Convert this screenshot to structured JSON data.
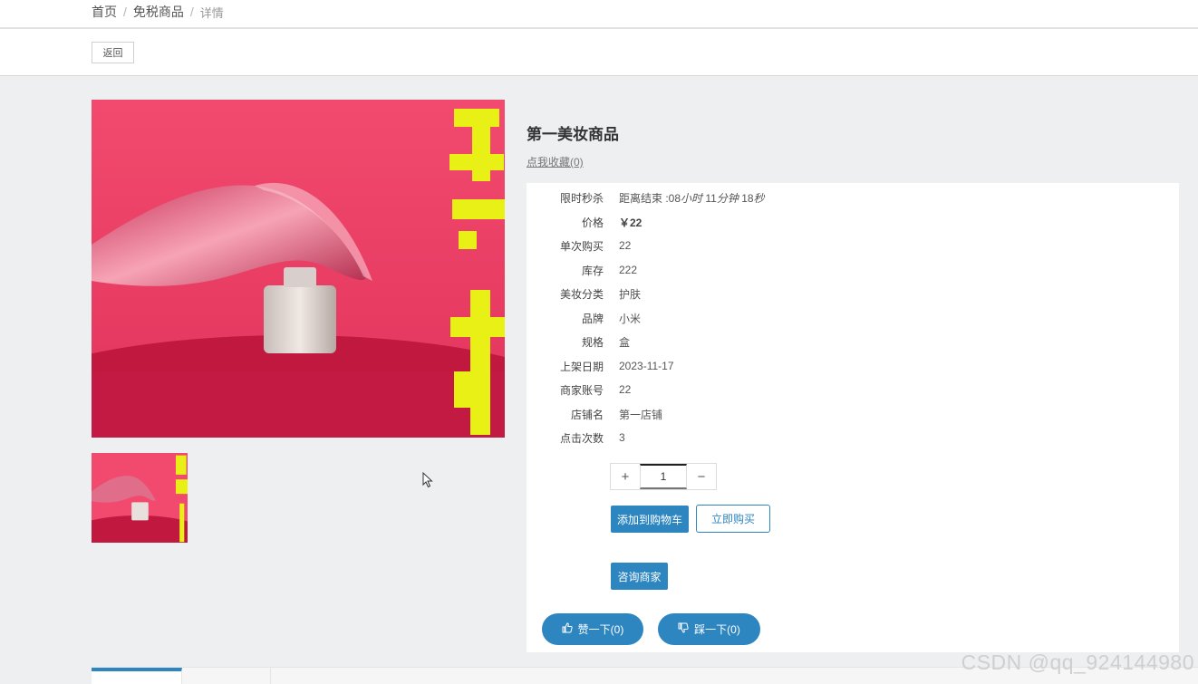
{
  "breadcrumb": {
    "home": "首页",
    "section": "免税商品",
    "current": "详情",
    "separator": "/"
  },
  "toolbar": {
    "back_label": "返回"
  },
  "product": {
    "title": "第一美妆商品",
    "favorite_label": "点我收藏(0)",
    "flash_sale": {
      "label": "限时秒杀",
      "prefix": "距离结束 :08",
      "hours_unit": "小时",
      "minutes": " 11",
      "minutes_unit": "分钟",
      "seconds": " 18",
      "seconds_unit": "秒"
    },
    "attributes": [
      {
        "label": "价格",
        "value": "￥22"
      },
      {
        "label": "单次购买",
        "value": "22"
      },
      {
        "label": "库存",
        "value": "222"
      },
      {
        "label": "美妆分类",
        "value": "护肤"
      },
      {
        "label": "品牌",
        "value": "小米"
      },
      {
        "label": "规格",
        "value": "盒"
      },
      {
        "label": "上架日期",
        "value": "2023-11-17"
      },
      {
        "label": "商家账号",
        "value": "22"
      },
      {
        "label": "店铺名",
        "value": "第一店铺"
      },
      {
        "label": "点击次数",
        "value": "3"
      }
    ],
    "quantity": {
      "value": "1",
      "plus": "+",
      "minus": "−"
    }
  },
  "actions": {
    "add_to_cart": "添加到购物车",
    "buy_now": "立即购买",
    "consult": "咨询商家",
    "like": "赞一下(0)",
    "dislike": "踩一下(0)"
  },
  "watermark": "CSDN @qq_924144980",
  "colors": {
    "primary": "#2e86c1",
    "image_magenta": "#ee3b63",
    "image_yellow": "#e9f016"
  },
  "icons": {
    "like": "thumbs-up-icon",
    "dislike": "thumbs-down-icon"
  }
}
